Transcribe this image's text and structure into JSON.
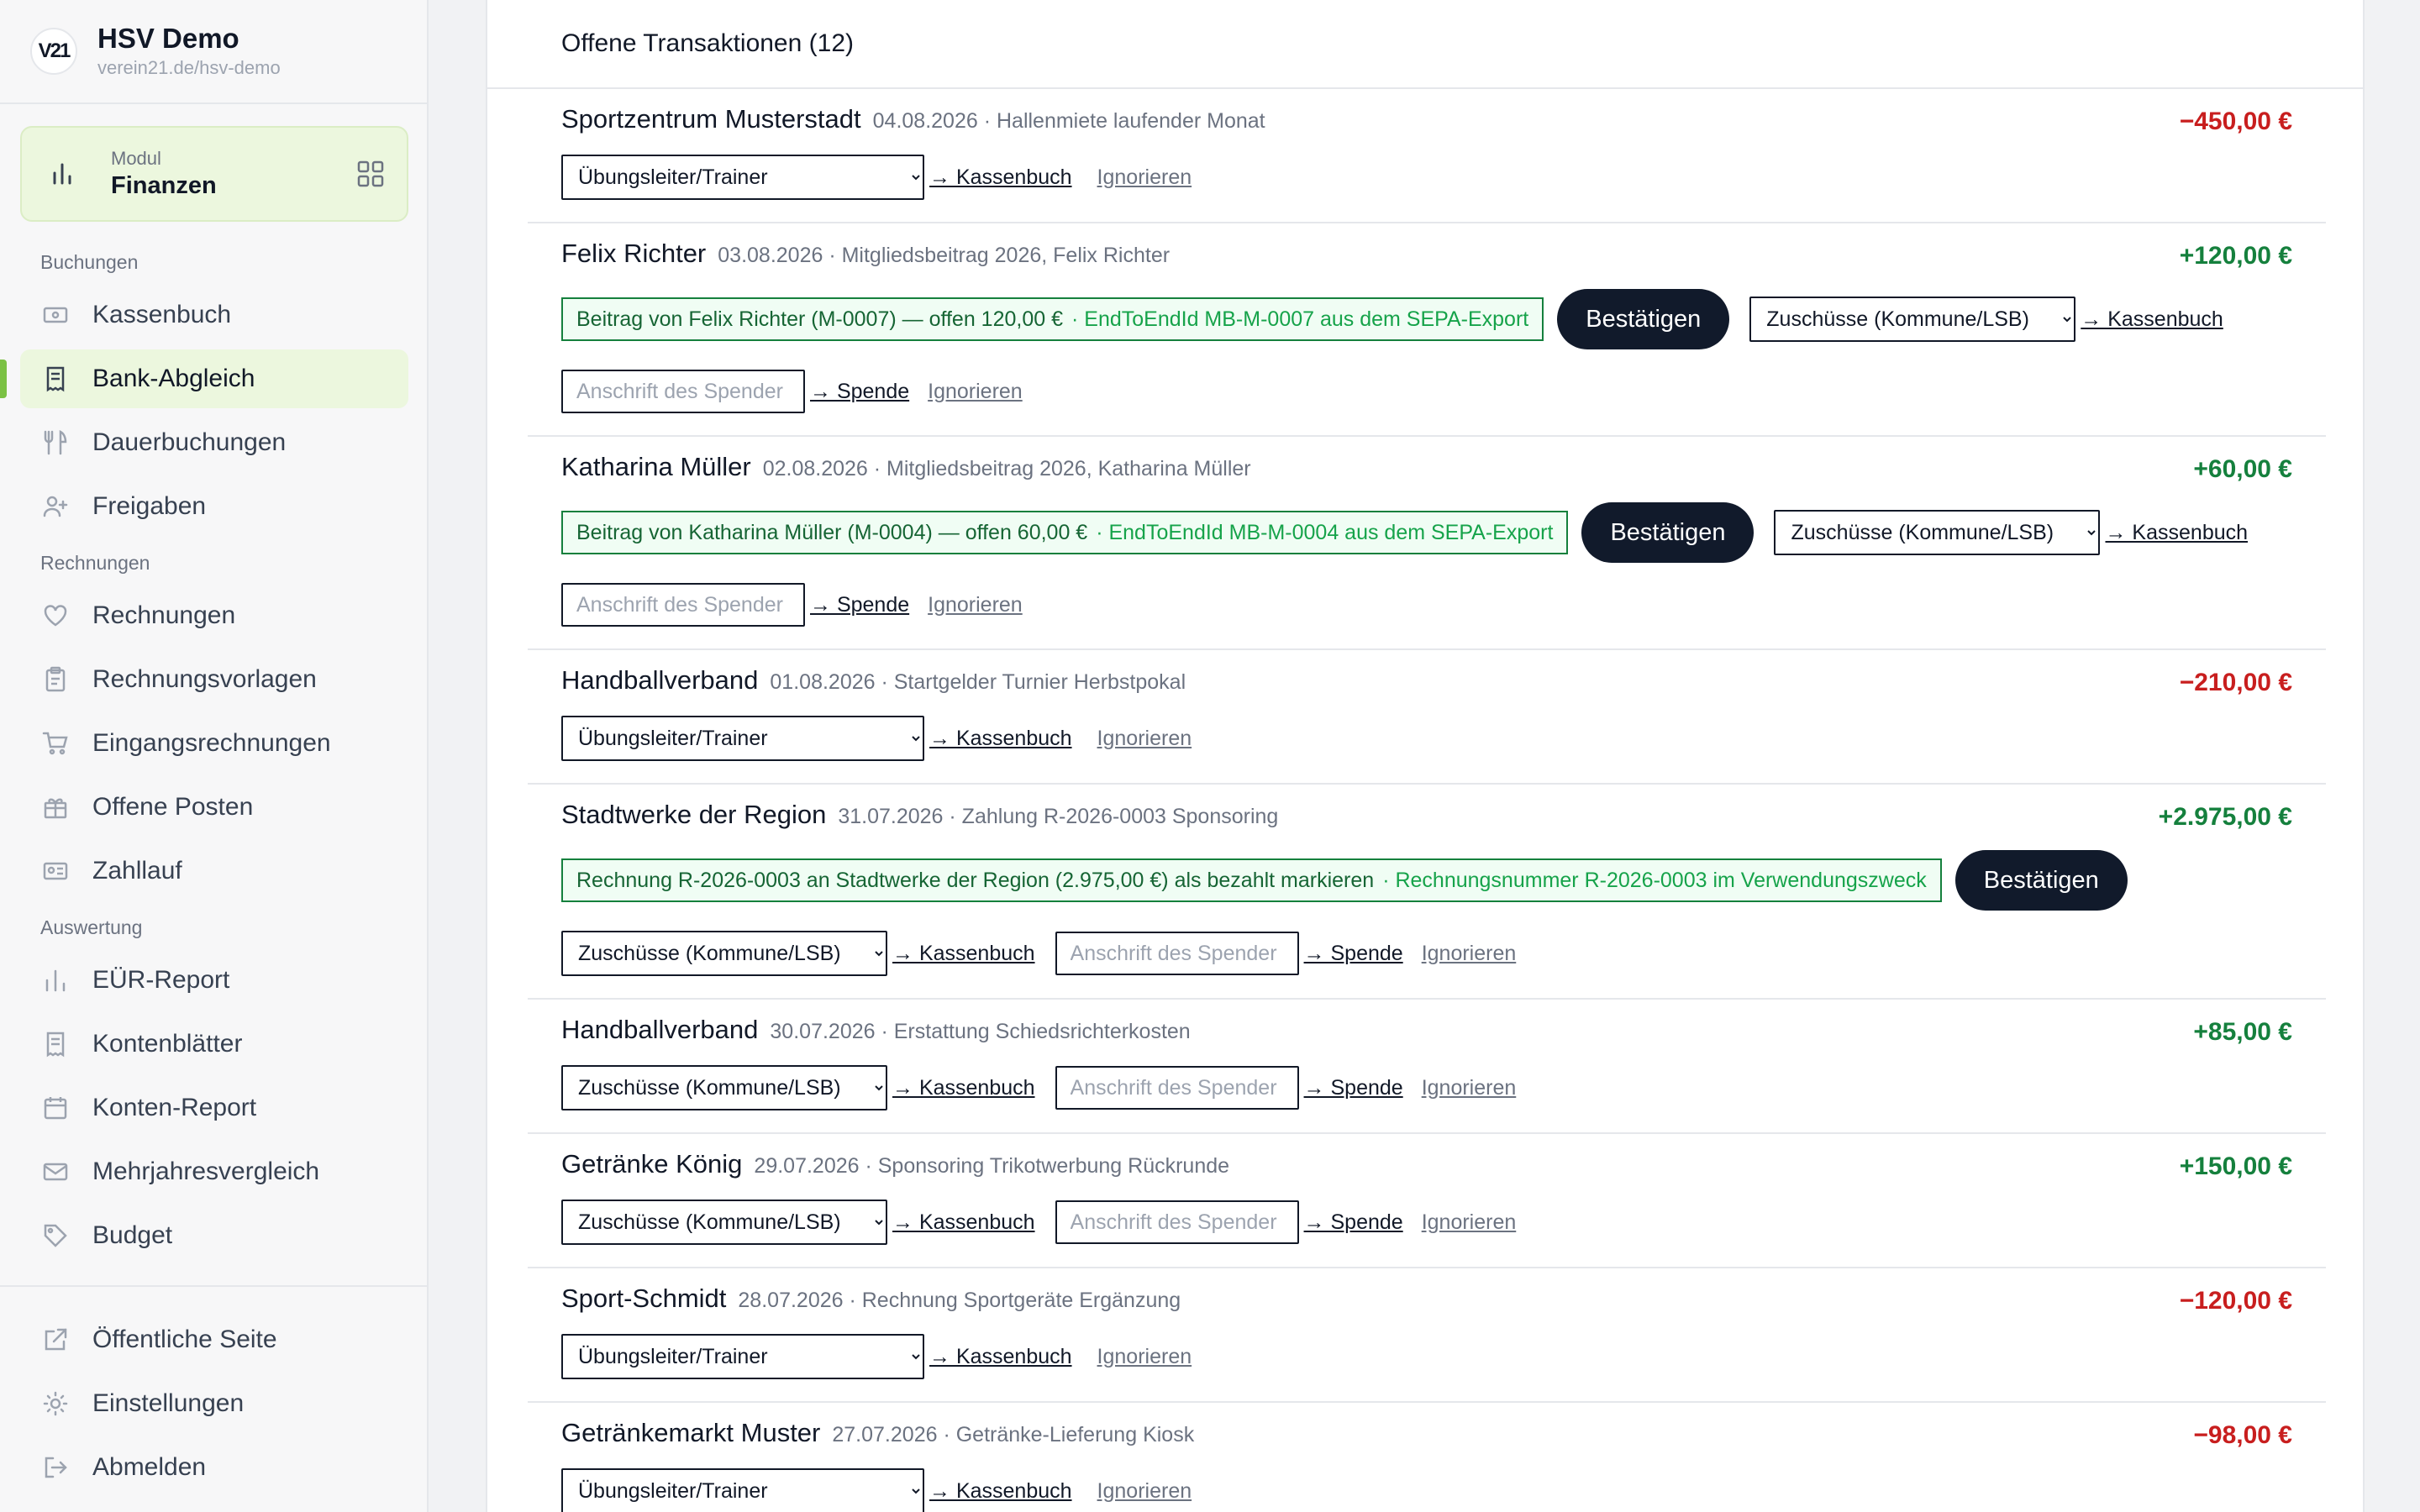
{
  "brand": {
    "logo": "V21",
    "name": "HSV Demo",
    "url": "verein21.de/hsv-demo"
  },
  "module": {
    "label_small": "Modul",
    "label": "Finanzen"
  },
  "nav": {
    "group_buchungen": "Buchungen",
    "kassenbuch": "Kassenbuch",
    "bank_abgleich": "Bank-Abgleich",
    "dauerbuchungen": "Dauerbuchungen",
    "freigaben": "Freigaben",
    "group_rechnungen": "Rechnungen",
    "rechnungen": "Rechnungen",
    "rechnungsvorlagen": "Rechnungsvorlagen",
    "eingangsrechnungen": "Eingangsrechnungen",
    "offene_posten": "Offene Posten",
    "zahllauf": "Zahllauf",
    "group_auswertung": "Auswertung",
    "eur_report": "EÜR-Report",
    "kontenblaetter": "Kontenblätter",
    "konten_report": "Konten-Report",
    "mehrjahresvergleich": "Mehrjahresvergleich",
    "budget": "Budget",
    "oeffentliche_seite": "Öffentliche Seite",
    "einstellungen": "Einstellungen",
    "abmelden": "Abmelden"
  },
  "colors": {
    "accent": "#7bc144",
    "negative": "#c81e1e",
    "positive": "#15803d",
    "confirm_bg": "#111a2b"
  },
  "main": {
    "title": "Offene Transaktionen (12)",
    "labels": {
      "kassenbuch_link": "→ Kassenbuch",
      "spende_link": "→ Spende",
      "ignore": "Ignorieren",
      "confirm": "Bestätigen",
      "donor_placeholder": "Anschrift des Spender",
      "cat_trainer": "Übungsleiter/Trainer",
      "cat_zuschuesse": "Zuschüsse (Kommune/LSB)"
    },
    "transactions": [
      {
        "name": "Sportzentrum Musterstadt",
        "meta": "04.08.2026 · Hallenmiete laufender Monat",
        "amount": "−450,00 €"
      },
      {
        "name": "Felix Richter",
        "meta": "03.08.2026 · Mitgliedsbeitrag 2026, Felix Richter",
        "amount": "+120,00 €",
        "match": "Beitrag von Felix Richter (M-0007) — offen 120,00 €",
        "hint": "· EndToEndId MB-M-0007 aus dem SEPA-Export"
      },
      {
        "name": "Katharina Müller",
        "meta": "02.08.2026 · Mitgliedsbeitrag 2026, Katharina Müller",
        "amount": "+60,00 €",
        "match": "Beitrag von Katharina Müller (M-0004) — offen 60,00 €",
        "hint": "· EndToEndId MB-M-0004 aus dem SEPA-Export"
      },
      {
        "name": "Handballverband",
        "meta": "01.08.2026 · Startgelder Turnier Herbstpokal",
        "amount": "−210,00 €"
      },
      {
        "name": "Stadtwerke der Region",
        "meta": "31.07.2026 · Zahlung R-2026-0003 Sponsoring",
        "amount": "+2.975,00 €",
        "match": "Rechnung R-2026-0003 an Stadtwerke der Region (2.975,00 €) als bezahlt markieren",
        "hint": "· Rechnungsnummer R-2026-0003 im Verwendungszweck"
      },
      {
        "name": "Handballverband",
        "meta": "30.07.2026 · Erstattung Schiedsrichterkosten",
        "amount": "+85,00 €"
      },
      {
        "name": "Getränke König",
        "meta": "29.07.2026 · Sponsoring Trikotwerbung Rückrunde",
        "amount": "+150,00 €"
      },
      {
        "name": "Sport-Schmidt",
        "meta": "28.07.2026 · Rechnung Sportgeräte Ergänzung",
        "amount": "−120,00 €"
      },
      {
        "name": "Getränkemarkt Muster",
        "meta": "27.07.2026 · Getränke-Lieferung Kiosk",
        "amount": "−98,00 €"
      }
    ]
  }
}
